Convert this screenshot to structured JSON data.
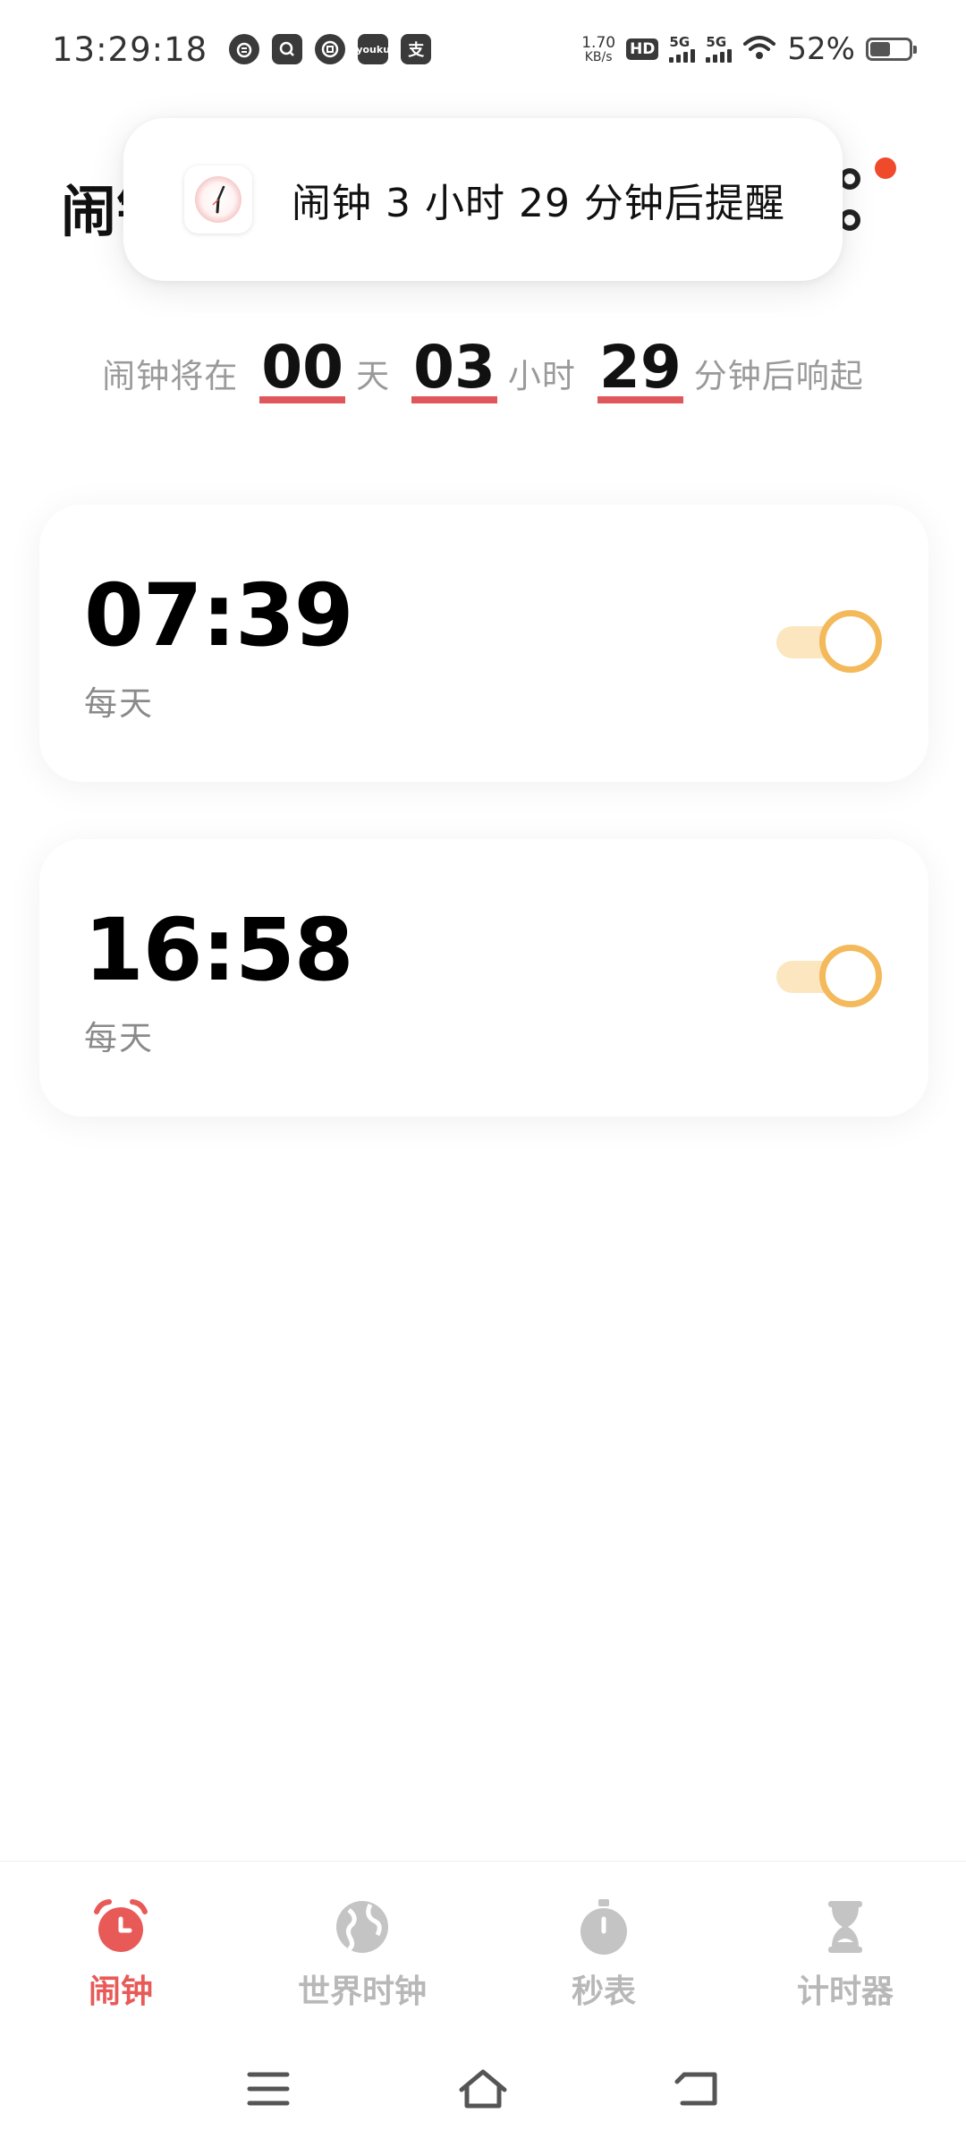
{
  "status_bar": {
    "time": "13:29:18",
    "app_icons": [
      "weibo-icon",
      "search-app-icon",
      "bank-icon",
      "youku-icon",
      "alipay-icon"
    ],
    "youku_label": "youku",
    "alipay_label": "支",
    "net_speed_value": "1.70",
    "net_speed_unit": "KB/s",
    "hd_label": "HD",
    "sim1_label": "5G",
    "sim2_label": "5G",
    "battery_percent": "52%",
    "battery_level": 0.52
  },
  "header": {
    "title": "闹钟"
  },
  "toast": {
    "message": "闹钟 3 小时 29 分钟后提醒"
  },
  "countdown": {
    "prefix": "闹钟将在",
    "days": "00",
    "days_label": "天",
    "hours": "03",
    "hours_label": "小时",
    "minutes": "29",
    "minutes_label": "分钟后响起"
  },
  "alarms": [
    {
      "time": "07:39",
      "repeat": "每天",
      "enabled": true
    },
    {
      "time": "16:58",
      "repeat": "每天",
      "enabled": true
    }
  ],
  "bottom_nav": [
    {
      "label": "闹钟",
      "icon": "alarm-clock-icon",
      "active": true
    },
    {
      "label": "世界时钟",
      "icon": "globe-icon",
      "active": false
    },
    {
      "label": "秒表",
      "icon": "stopwatch-icon",
      "active": false
    },
    {
      "label": "计时器",
      "icon": "hourglass-icon",
      "active": false
    }
  ],
  "colors": {
    "accent": "#e85a58",
    "underline": "#e0575b",
    "toggle_track": "#fbe6bf",
    "toggle_knob_border": "#f3b95a",
    "notification_dot": "#f04a2c",
    "inactive_nav": "#b8b8b8"
  }
}
